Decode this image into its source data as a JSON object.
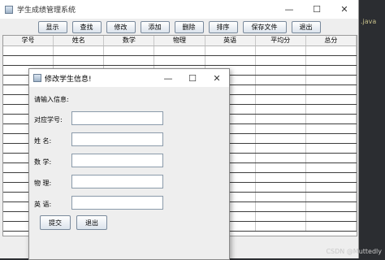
{
  "window": {
    "title": "学生成绩管理系统",
    "minimize": "—",
    "maximize": "☐",
    "close": "✕"
  },
  "ide": {
    "tag": ".java"
  },
  "watermark": "CSDN @Muttedly",
  "toolbar": {
    "buttons": [
      "显示",
      "查找",
      "修改",
      "添加",
      "删除",
      "排序",
      "保存文件",
      "退出"
    ]
  },
  "table": {
    "columns": [
      "学号",
      "姓名",
      "数学",
      "物理",
      "英语",
      "平均分",
      "总分"
    ],
    "rows": []
  },
  "dialog": {
    "title": "修改学生信息!",
    "minimize": "—",
    "maximize": "☐",
    "close": "✕",
    "prompt": "请输入信息:",
    "fields": [
      {
        "label": "对应学号:",
        "value": ""
      },
      {
        "label": "姓    名:",
        "value": ""
      },
      {
        "label": "数    学:",
        "value": ""
      },
      {
        "label": "物    理:",
        "value": ""
      },
      {
        "label": "英    语:",
        "value": ""
      }
    ],
    "submit": "提交",
    "exit": "退出"
  }
}
